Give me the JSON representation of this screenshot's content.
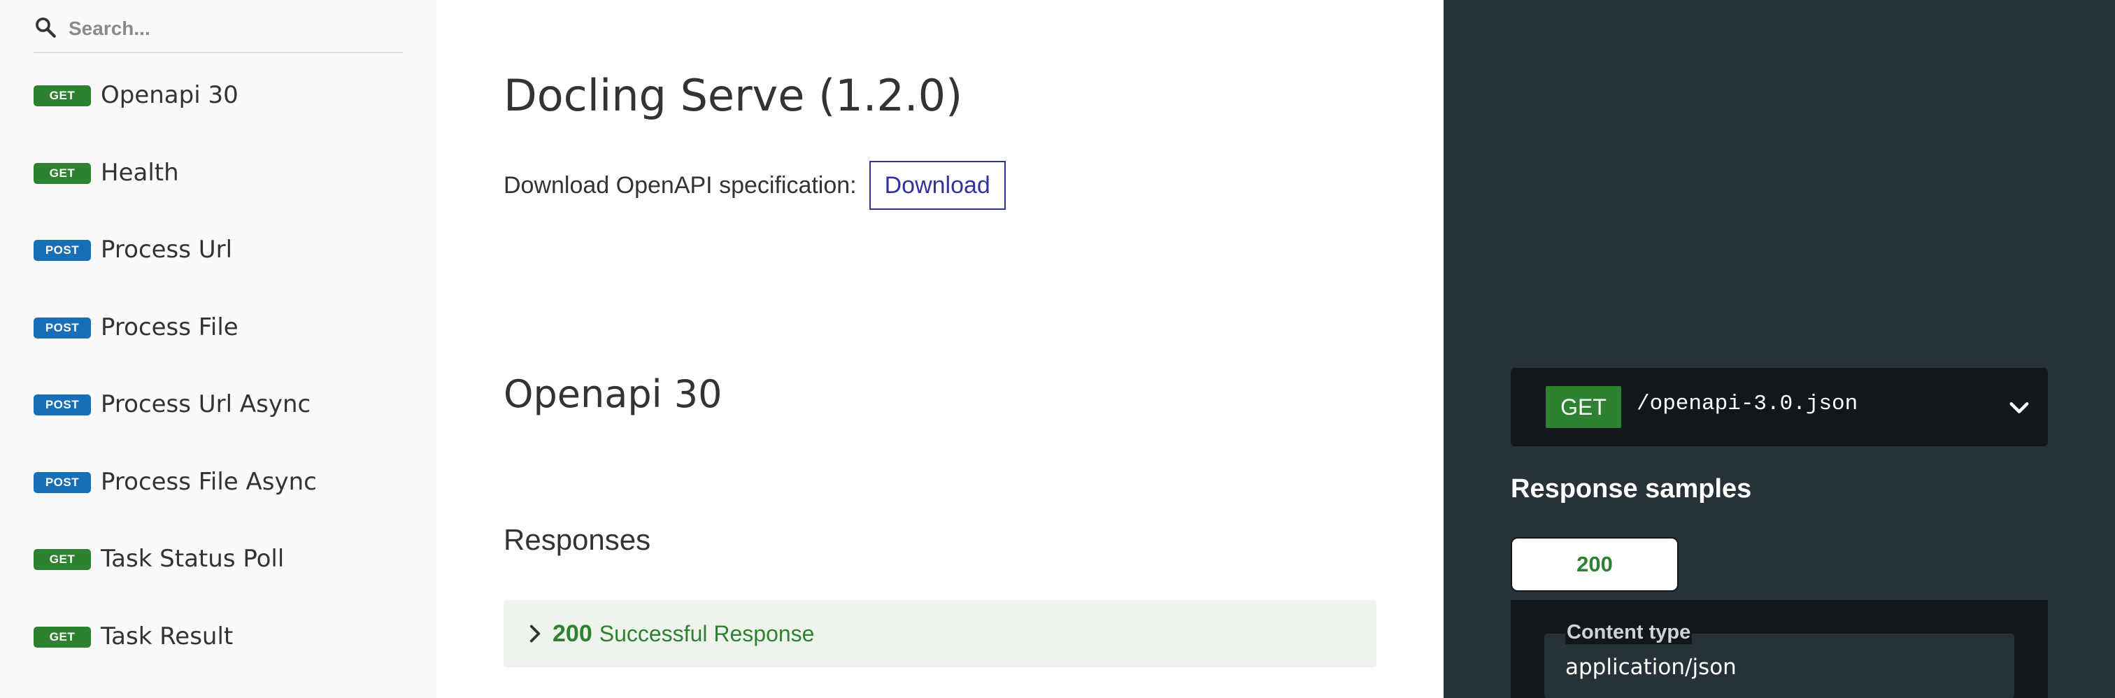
{
  "search": {
    "placeholder": "Search..."
  },
  "sidebar": {
    "items": [
      {
        "method": "GET",
        "label": "Openapi 30"
      },
      {
        "method": "GET",
        "label": "Health"
      },
      {
        "method": "POST",
        "label": "Process Url"
      },
      {
        "method": "POST",
        "label": "Process File"
      },
      {
        "method": "POST",
        "label": "Process Url Async"
      },
      {
        "method": "POST",
        "label": "Process File Async"
      },
      {
        "method": "GET",
        "label": "Task Status Poll"
      },
      {
        "method": "GET",
        "label": "Task Result"
      }
    ]
  },
  "main": {
    "title": "Docling Serve (1.2.0)",
    "download_label": "Download OpenAPI specification:",
    "download_button": "Download",
    "section_title": "Openapi 30",
    "responses_heading": "Responses",
    "response": {
      "code": "200",
      "description": "Successful Response"
    }
  },
  "right_panel": {
    "endpoint": {
      "method": "GET",
      "path": "/openapi-3.0.json"
    },
    "samples_title": "Response samples",
    "status_tab": "200",
    "content_type_label": "Content type",
    "content_type_value": "application/json"
  },
  "colors": {
    "get": "#2f8132",
    "post": "#186fb5",
    "link": "#32329f",
    "right_panel_bg": "#263238",
    "dark_bg": "#11171a"
  },
  "icons": {
    "search": "search-icon",
    "response_toggle": "chevron-right-icon",
    "endpoint_toggle": "chevron-down-icon"
  }
}
